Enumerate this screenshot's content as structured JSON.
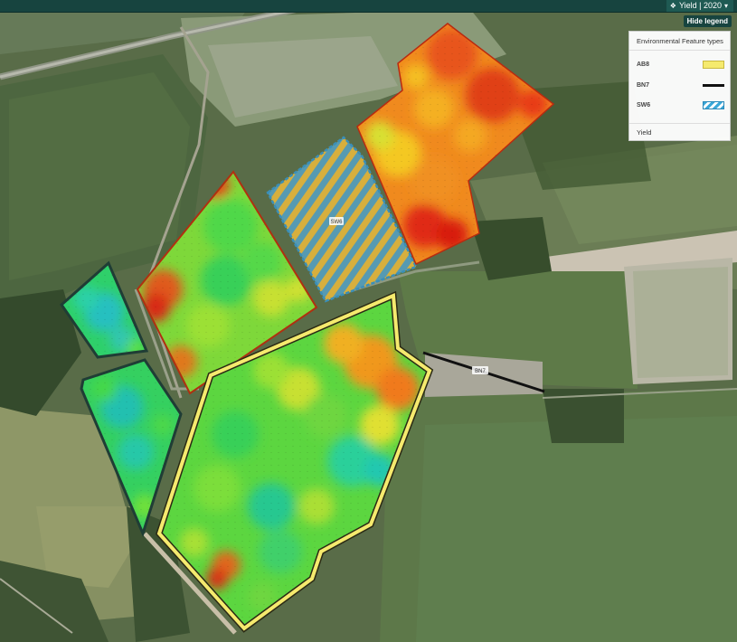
{
  "header": {
    "layer_selector": "Yield | 2020",
    "layer_icon": "layers-icon",
    "dropdown_icon": "caret-down-icon"
  },
  "legend": {
    "toggle_label": "Hide legend",
    "title": "Environmental Feature types",
    "items": [
      {
        "code": "AB8",
        "swatch": "#f5ea6e"
      },
      {
        "code": "BN7",
        "swatch": "#111111"
      },
      {
        "code": "SW6",
        "swatch": "#3aa8d8"
      }
    ],
    "footer": "Yield"
  },
  "map_labels": {
    "sw6": "SW6",
    "bn7": "BN7"
  },
  "colors": {
    "yield_low": "#d81e10",
    "yield_mid": "#e8e820",
    "yield_high": "#19c08a",
    "ab8_border": "#f5ea6e",
    "sw6_stripe": "#3aa8d8"
  }
}
